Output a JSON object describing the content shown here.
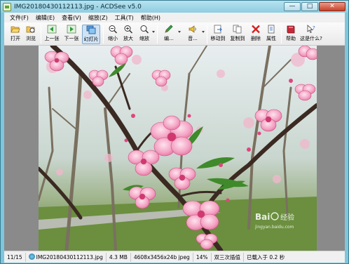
{
  "window": {
    "title": "IMG20180430112113.jpg - ACDSee v5.0",
    "controls": {
      "minimize": "—",
      "maximize": "□",
      "close": "✕"
    }
  },
  "menu": [
    "文件(F)",
    "编辑(E)",
    "查看(V)",
    "缩放(Z)",
    "工具(T)",
    "帮助(H)"
  ],
  "toolbar": {
    "open": "打开",
    "browse": "浏览",
    "prev": "上一张",
    "next": "下一张",
    "slideshow": "幻灯片",
    "zoom_out": "缩小",
    "zoom_in": "放大",
    "zoom": "缩放",
    "edit": "编...",
    "audio": "音...",
    "move_to": "移动到",
    "copy_to": "复制到",
    "delete": "删除",
    "properties": "属性",
    "help": "帮助",
    "whats_this": "这是什么?"
  },
  "status": {
    "position": "11/15",
    "filename": "IMG20180430112113.jpg",
    "size": "4.3 MB",
    "dimensions": "4608x3456x24b jpeg",
    "zoom": "14%",
    "interp": "双三次插值",
    "load": "已载入于 0.2 秒"
  },
  "watermark": {
    "brand": "Bai",
    "site": "jingyan.baidu.com",
    "suffix": "经验"
  },
  "colors": {
    "frame": "#7fc6dc",
    "toolbar_active": "#cfe3f5",
    "blossom": "#f07aa8"
  }
}
